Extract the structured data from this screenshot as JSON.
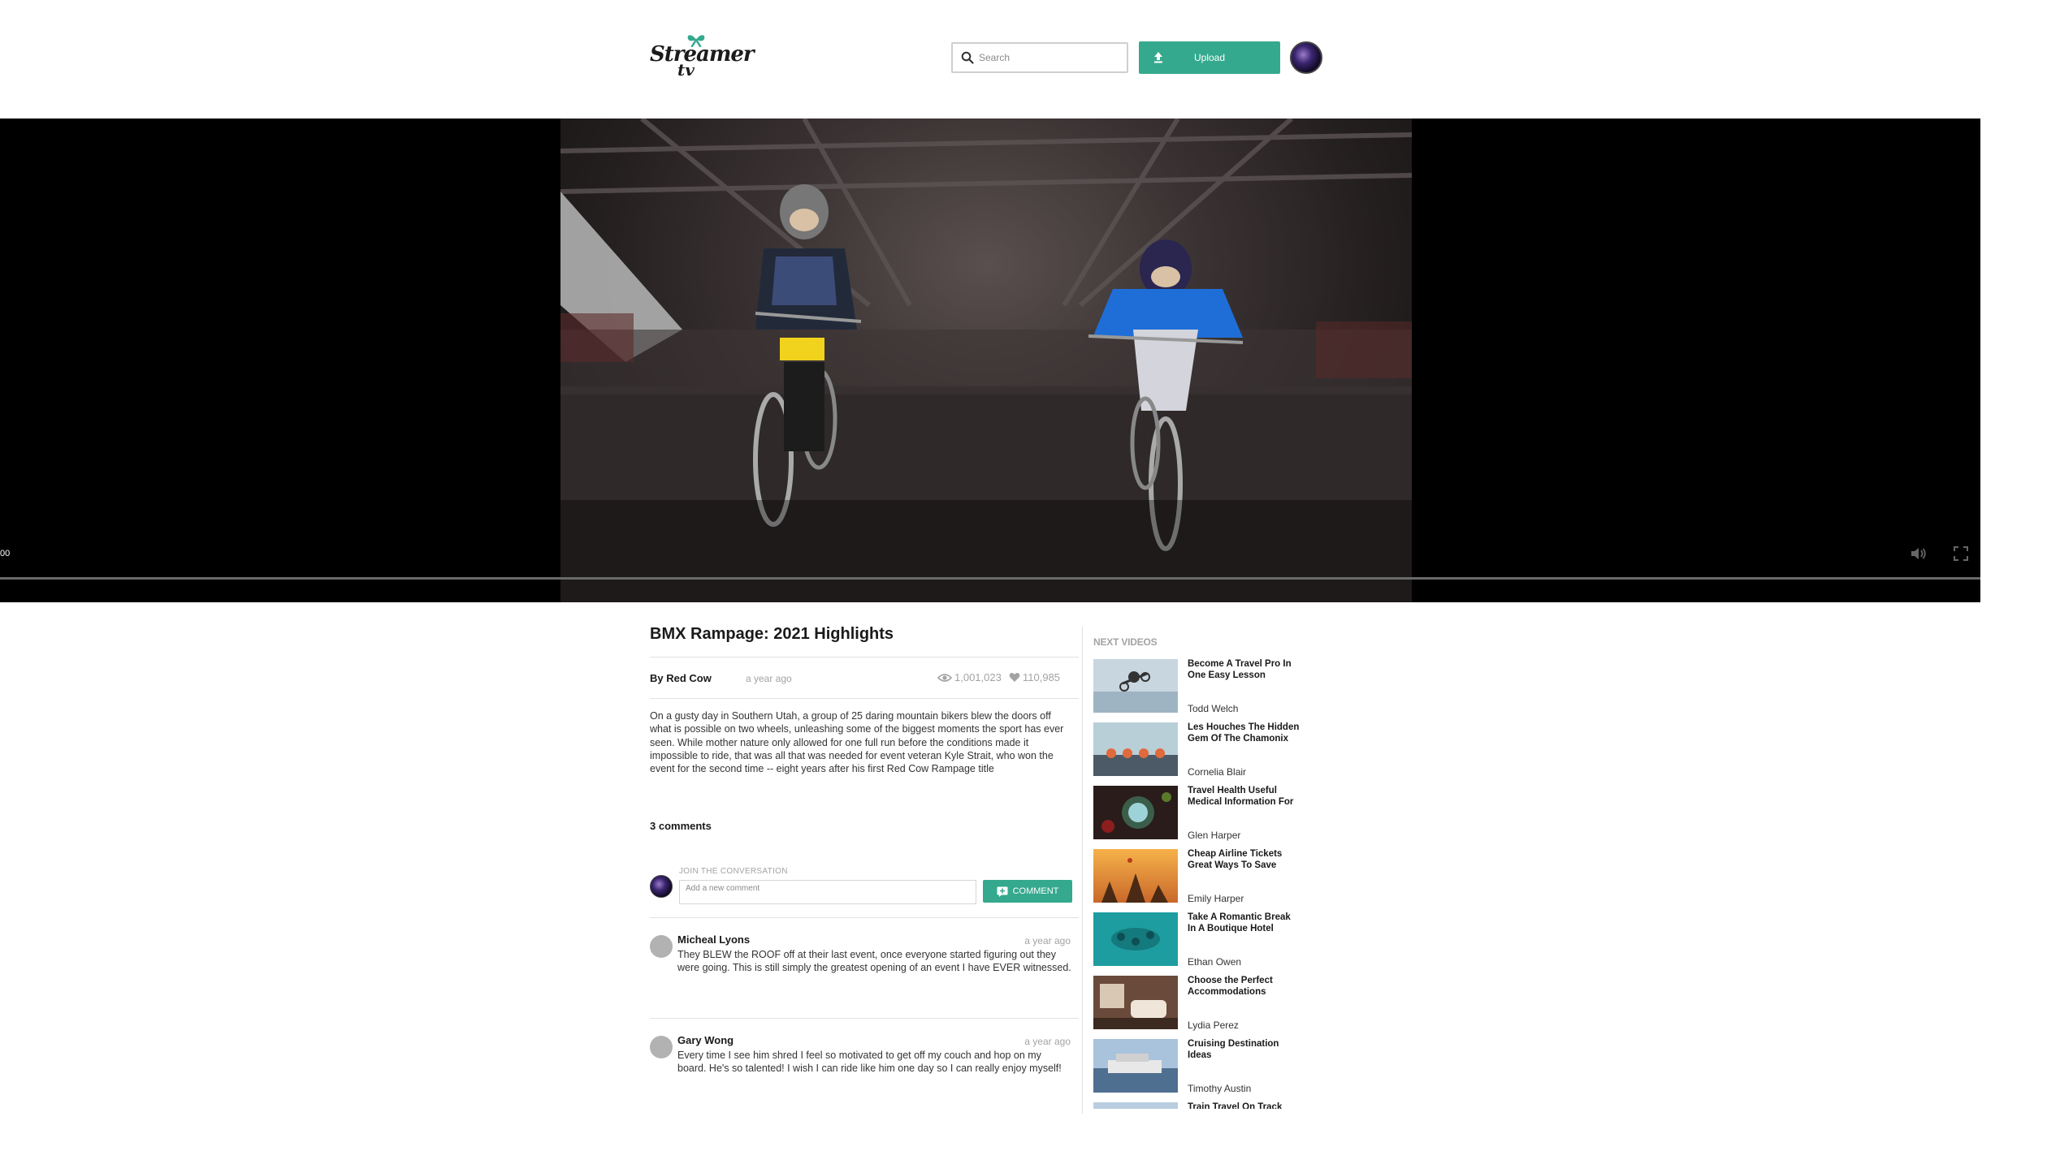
{
  "brand": {
    "name": "Streamer",
    "suffix": "tv"
  },
  "header": {
    "search_placeholder": "Search",
    "upload_label": "Upload"
  },
  "player": {
    "time_display": "00",
    "progress": 0
  },
  "video": {
    "title": "BMX Rampage: 2021 Highlights",
    "by_line": "By Red Cow",
    "posted": "a year ago",
    "views": "1,001,023",
    "likes": "110,985",
    "description": "On a gusty day in Southern Utah, a group of 25 daring mountain bikers blew the doors off what is possible on two wheels, unleashing some of the biggest moments the sport has ever seen. While mother nature only allowed for one full run before the conditions made it impossible to ride, that was all that was needed for event veteran Kyle Strait, who won the event for the second time -- eight years after his first Red Cow Rampage title"
  },
  "comments_section": {
    "count_label": "3 comments",
    "join_label": "JOIN THE CONVERSATION",
    "input_placeholder": "Add a new comment",
    "button_label": "COMMENT",
    "comments": [
      {
        "name": "Micheal Lyons",
        "time": "a year ago",
        "text": "They BLEW the ROOF off at their last event, once everyone started figuring out they were going. This is still simply the greatest opening of an event I have EVER witnessed."
      },
      {
        "name": "Gary Wong",
        "time": "a year ago",
        "text": "Every time I see him shred I feel so motivated to get off my couch and hop on my board. He's so talented! I wish I can ride like him one day so I can really enjoy myself!"
      }
    ]
  },
  "sidebar": {
    "heading": "NEXT VIDEOS",
    "items": [
      {
        "title": "Become A Travel Pro In One Easy Lesson",
        "author": "Todd Welch"
      },
      {
        "title": "Les Houches The Hidden Gem Of The Chamonix",
        "author": "Cornelia Blair"
      },
      {
        "title": "Travel Health Useful Medical Information For",
        "author": "Glen Harper"
      },
      {
        "title": "Cheap Airline Tickets Great Ways To Save",
        "author": "Emily Harper"
      },
      {
        "title": "Take A Romantic Break In A Boutique Hotel",
        "author": "Ethan Owen"
      },
      {
        "title": "Choose the Perfect Accommodations",
        "author": "Lydia Perez"
      },
      {
        "title": "Cruising Destination Ideas",
        "author": "Timothy Austin"
      },
      {
        "title": "Train Travel On Track",
        "author": ""
      }
    ]
  },
  "colors": {
    "accent": "#34a98e",
    "muted": "#a3a3a3",
    "divider": "#e2e2e2"
  }
}
